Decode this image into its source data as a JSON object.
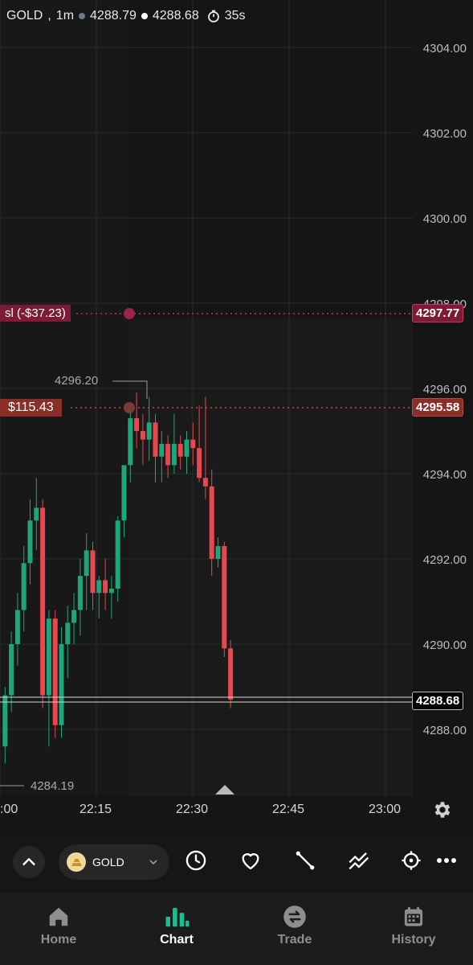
{
  "header": {
    "symbol": "GOLD",
    "separator": ",",
    "timeframe": "1m",
    "bid": "4288.79",
    "ask": "4288.68",
    "timer": "35s"
  },
  "y_axis_labels": [
    "4304.00",
    "4302.00",
    "4300.00",
    "4298.00",
    "4296.00",
    "4294.00",
    "4292.00",
    "4290.00",
    "4288.00"
  ],
  "x_axis_labels": [
    ":00",
    "22:15",
    "22:30",
    "22:45",
    "23:00"
  ],
  "lines": {
    "sl_label": "sl (-$37.23)",
    "sl_price": "4297.77",
    "position_label": "$115.43",
    "position_price": "4295.58",
    "current_price": "4288.68"
  },
  "annotations": {
    "high": "4296.20",
    "low": "4284.19"
  },
  "colors": {
    "up": "#1fa57a",
    "down": "#e8474f",
    "sl": "#7c1b36",
    "position": "#8a2e28",
    "accent": "#19c08f"
  },
  "toolbar": {
    "symbol_label": "GOLD",
    "icons": [
      "chevron-up-icon",
      "gold-bars-icon",
      "chevron-down-icon",
      "clock-icon",
      "heart-icon",
      "trendline-icon",
      "indicators-icon",
      "crosshair-icon",
      "more-icon"
    ]
  },
  "bottom_nav": [
    {
      "label": "Home",
      "icon": "home-icon",
      "active": false
    },
    {
      "label": "Chart",
      "icon": "chart-icon",
      "active": true
    },
    {
      "label": "Trade",
      "icon": "trade-icon",
      "active": false
    },
    {
      "label": "History",
      "icon": "calendar-icon",
      "active": false
    }
  ],
  "chart_data": {
    "type": "candlestick",
    "timeframe": "1m",
    "ylim": [
      4284.0,
      4305.0
    ],
    "x_ticks": [
      ":00",
      "22:15",
      "22:30",
      "22:45",
      "23:00"
    ],
    "candles": [
      [
        4287.6,
        4289.0,
        4287.2,
        4288.8
      ],
      [
        4288.8,
        4290.3,
        4288.4,
        4290.0
      ],
      [
        4290.0,
        4291.2,
        4289.5,
        4290.8
      ],
      [
        4290.8,
        4292.3,
        4290.3,
        4291.9
      ],
      [
        4291.9,
        4293.4,
        4291.4,
        4292.9
      ],
      [
        4292.9,
        4293.9,
        4292.2,
        4293.2
      ],
      [
        4293.2,
        4293.4,
        4288.5,
        4288.8
      ],
      [
        4288.8,
        4290.8,
        4287.6,
        4290.6
      ],
      [
        4290.6,
        4290.8,
        4287.8,
        4288.1
      ],
      [
        4288.1,
        4290.4,
        4287.8,
        4290.0
      ],
      [
        4290.0,
        4290.9,
        4289.2,
        4290.5
      ],
      [
        4290.5,
        4291.2,
        4290.0,
        4290.8
      ],
      [
        4290.8,
        4292.0,
        4290.2,
        4291.6
      ],
      [
        4291.6,
        4292.6,
        4290.8,
        4292.2
      ],
      [
        4292.2,
        4292.4,
        4290.8,
        4291.2
      ],
      [
        4291.2,
        4291.6,
        4290.6,
        4291.5
      ],
      [
        4291.5,
        4292.0,
        4290.8,
        4291.2
      ],
      [
        4291.2,
        4291.6,
        4290.6,
        4291.3
      ],
      [
        4291.3,
        4293.0,
        4291.0,
        4292.9
      ],
      [
        4292.9,
        4294.0,
        4292.5,
        4294.2
      ],
      [
        4294.2,
        4295.6,
        4293.8,
        4295.3
      ],
      [
        4295.3,
        4295.9,
        4294.6,
        4295.0
      ],
      [
        4295.0,
        4295.4,
        4294.2,
        4294.8
      ],
      [
        4294.8,
        4295.8,
        4294.3,
        4295.2
      ],
      [
        4295.2,
        4295.4,
        4293.8,
        4294.4
      ],
      [
        4294.4,
        4295.0,
        4293.8,
        4294.7
      ],
      [
        4294.7,
        4294.9,
        4293.9,
        4294.2
      ],
      [
        4294.2,
        4295.4,
        4294.0,
        4294.7
      ],
      [
        4294.7,
        4294.9,
        4294.1,
        4294.4
      ],
      [
        4294.4,
        4295.0,
        4294.0,
        4294.8
      ],
      [
        4294.8,
        4295.2,
        4294.2,
        4294.6
      ],
      [
        4294.6,
        4295.6,
        4293.8,
        4293.9
      ],
      [
        4293.9,
        4295.8,
        4293.4,
        4293.7
      ],
      [
        4293.7,
        4294.1,
        4291.6,
        4292.0
      ],
      [
        4292.0,
        4292.5,
        4291.8,
        4292.3
      ],
      [
        4292.3,
        4292.4,
        4289.7,
        4289.9
      ],
      [
        4289.9,
        4290.1,
        4288.5,
        4288.7
      ]
    ]
  }
}
